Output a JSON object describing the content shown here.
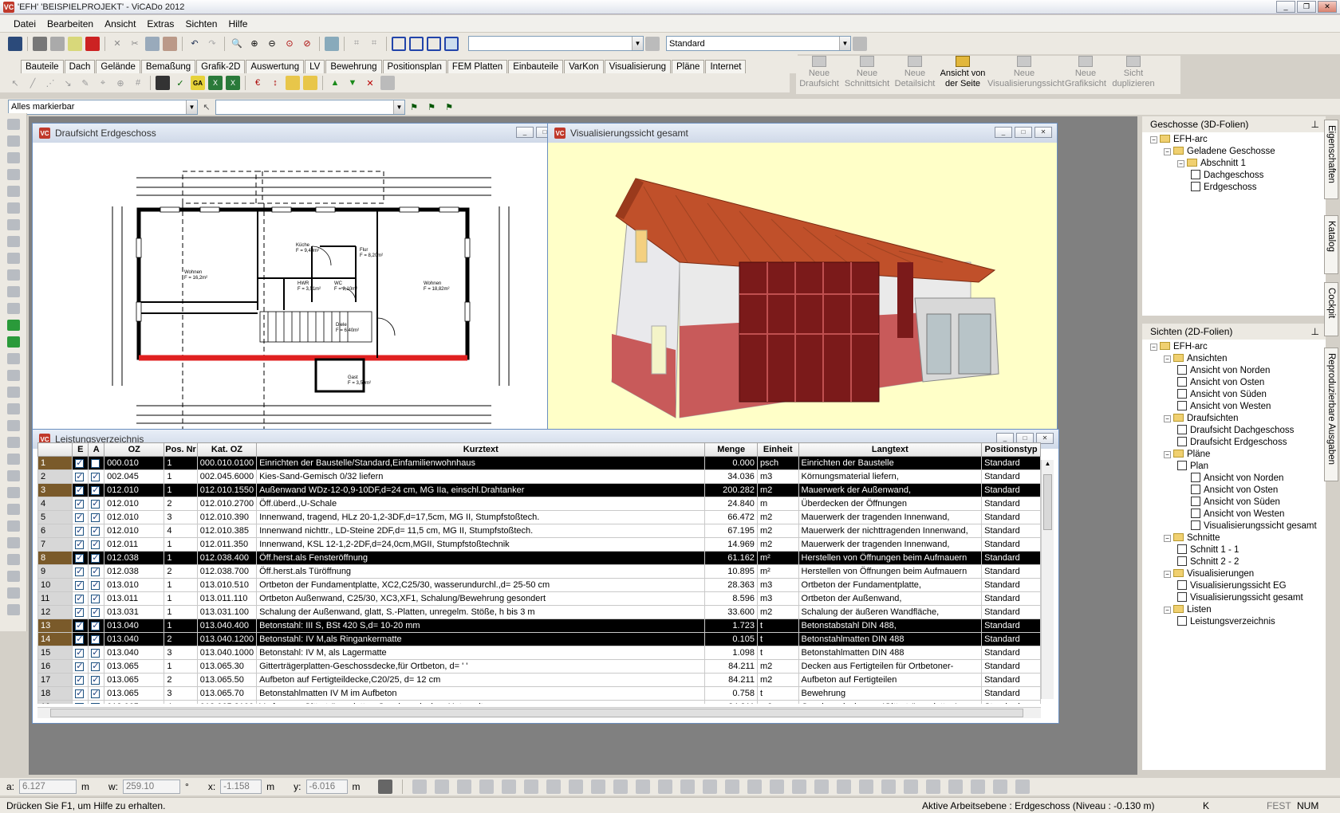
{
  "window": {
    "title": "'EFH' 'BEISPIELPROJEKT' - ViCADo 2012",
    "logo": "VC"
  },
  "menu": [
    "Datei",
    "Bearbeiten",
    "Ansicht",
    "Extras",
    "Sichten",
    "Hilfe"
  ],
  "toolbar": {
    "layer_combo": "",
    "style_combo": "Standard",
    "select_combo": "Alles markierbar",
    "filter_combo": ""
  },
  "tabs": [
    "Bauteile",
    "Dach",
    "Gelände",
    "Bemaßung",
    "Grafik-2D",
    "Auswertung",
    "LV",
    "Bewehrung",
    "Positionsplan",
    "FEM Platten",
    "Einbauteile",
    "VarKon",
    "Visualisierung",
    "Pläne",
    "Internet"
  ],
  "view_buttons": [
    {
      "label1": "Neue",
      "label2": "Draufsicht",
      "enabled": false
    },
    {
      "label1": "Neue",
      "label2": "Schnittsicht",
      "enabled": false
    },
    {
      "label1": "Neue",
      "label2": "Detailsicht",
      "enabled": false
    },
    {
      "label1": "Ansicht von",
      "label2": "der Seite",
      "enabled": true
    },
    {
      "label1": "Neue",
      "label2": "Visualisierungssicht",
      "enabled": false
    },
    {
      "label1": "Neue",
      "label2": "Grafiksicht",
      "enabled": false
    },
    {
      "label1": "Sicht",
      "label2": "duplizieren",
      "enabled": false
    }
  ],
  "panels": {
    "floorplan": {
      "title": "Draufsicht Erdgeschoss"
    },
    "visual": {
      "title": "Visualisierungssicht gesamt"
    },
    "lv": {
      "title": "Leistungsverzeichnis"
    }
  },
  "floorplan_rooms": [
    {
      "name": "Wohnen",
      "area": "F = 16,2m²"
    },
    {
      "name": "Küche",
      "area": "F = 9,40m²"
    },
    {
      "name": "Flur",
      "area": "F = 8,20m²"
    },
    {
      "name": "HWR",
      "area": "F = 3,51m²"
    },
    {
      "name": "WC",
      "area": "F = 2,10m²"
    },
    {
      "name": "Diele",
      "area": "F = 6,40m²"
    },
    {
      "name": "Wohnen",
      "area": "F = 18,82m²"
    },
    {
      "name": "Gast",
      "area": "F = 3,50m²"
    }
  ],
  "lv_table": {
    "columns": [
      "",
      "E",
      "A",
      "OZ",
      "Pos. Nr",
      "Kat. OZ",
      "Kurztext",
      "Menge",
      "Einheit",
      "Langtext",
      "Positionstyp"
    ],
    "rows": [
      {
        "n": "1",
        "e": true,
        "a": false,
        "oz": "000.010",
        "pos": "1",
        "kat": "000.010.0100",
        "kurz": "Einrichten der Baustelle/Standard,Einfamilienwohnhaus",
        "menge": "0.000",
        "einheit": "psch",
        "lang": "Einrichten der Baustelle",
        "typ": "Standard",
        "dark": true
      },
      {
        "n": "2",
        "e": true,
        "a": true,
        "oz": "002.045",
        "pos": "1",
        "kat": "002.045.6000",
        "kurz": "Kies-Sand-Gemisch 0/32 liefern",
        "menge": "34.036",
        "einheit": "m3",
        "lang": "Körnungsmaterial liefern,",
        "typ": "Standard",
        "dark": false
      },
      {
        "n": "3",
        "e": true,
        "a": true,
        "oz": "012.010",
        "pos": "1",
        "kat": "012.010.1550",
        "kurz": "Außenwand WDz-12-0,9-10DF,d=24 cm, MG IIa, einschl.Drahtanker",
        "menge": "200.282",
        "einheit": "m2",
        "lang": "Mauerwerk der Außenwand,",
        "typ": "Standard",
        "dark": true
      },
      {
        "n": "4",
        "e": true,
        "a": true,
        "oz": "012.010",
        "pos": "2",
        "kat": "012.010.2700",
        "kurz": "Öff.überd.,U-Schale",
        "menge": "24.840",
        "einheit": "m",
        "lang": "Überdecken der Öffnungen",
        "typ": "Standard",
        "dark": false
      },
      {
        "n": "5",
        "e": true,
        "a": true,
        "oz": "012.010",
        "pos": "3",
        "kat": "012.010.390",
        "kurz": "Innenwand, tragend, HLz 20-1,2-3DF,d=17,5cm, MG II, Stumpfstoßtech.",
        "menge": "66.472",
        "einheit": "m2",
        "lang": "Mauerwerk der tragenden Innenwand,",
        "typ": "Standard",
        "dark": false
      },
      {
        "n": "6",
        "e": true,
        "a": true,
        "oz": "012.010",
        "pos": "4",
        "kat": "012.010.385",
        "kurz": "Innenwand nichttr., LD-Steine 2DF,d= 11,5 cm, MG II, Stumpfstoßtech.",
        "menge": "67.195",
        "einheit": "m2",
        "lang": "Mauerwerk der nichttragenden Innenwand,",
        "typ": "Standard",
        "dark": false
      },
      {
        "n": "7",
        "e": true,
        "a": true,
        "oz": "012.011",
        "pos": "1",
        "kat": "012.011.350",
        "kurz": "Innenwand, KSL 12-1,2-2DF,d=24,0cm,MGII, Stumpfstoßtechnik",
        "menge": "14.969",
        "einheit": "m2",
        "lang": "Mauerwerk der tragenden Innenwand,",
        "typ": "Standard",
        "dark": false
      },
      {
        "n": "8",
        "e": true,
        "a": true,
        "oz": "012.038",
        "pos": "1",
        "kat": "012.038.400",
        "kurz": "Öff.herst.als Fensteröffnung",
        "menge": "61.162",
        "einheit": "m²",
        "lang": "Herstellen von Öffnungen beim Aufmauern",
        "typ": "Standard",
        "dark": true
      },
      {
        "n": "9",
        "e": true,
        "a": true,
        "oz": "012.038",
        "pos": "2",
        "kat": "012.038.700",
        "kurz": "Öff.herst.als Türöffnung",
        "menge": "10.895",
        "einheit": "m²",
        "lang": "Herstellen von Öffnungen beim Aufmauern",
        "typ": "Standard",
        "dark": false
      },
      {
        "n": "10",
        "e": true,
        "a": true,
        "oz": "013.010",
        "pos": "1",
        "kat": "013.010.510",
        "kurz": "Ortbeton der Fundamentplatte, XC2,C25/30, wasserundurchl.,d= 25-50 cm",
        "menge": "28.363",
        "einheit": "m3",
        "lang": "Ortbeton der Fundamentplatte,",
        "typ": "Standard",
        "dark": false
      },
      {
        "n": "11",
        "e": true,
        "a": true,
        "oz": "013.011",
        "pos": "1",
        "kat": "013.011.110",
        "kurz": "Ortbeton Außenwand, C25/30, XC3,XF1, Schalung/Bewehrung gesondert",
        "menge": "8.596",
        "einheit": "m3",
        "lang": "Ortbeton der Außenwand,",
        "typ": "Standard",
        "dark": false
      },
      {
        "n": "12",
        "e": true,
        "a": true,
        "oz": "013.031",
        "pos": "1",
        "kat": "013.031.100",
        "kurz": "Schalung der Außenwand, glatt, S.-Platten, unregelm. Stöße, h bis 3 m",
        "menge": "33.600",
        "einheit": "m2",
        "lang": "Schalung der äußeren Wandfläche,",
        "typ": "Standard",
        "dark": false
      },
      {
        "n": "13",
        "e": true,
        "a": true,
        "oz": "013.040",
        "pos": "1",
        "kat": "013.040.400",
        "kurz": "Betonstahl: III S, BSt 420 S,d= 10-20 mm",
        "menge": "1.723",
        "einheit": "t",
        "lang": "Betonstabstahl DIN 488,",
        "typ": "Standard",
        "dark": true
      },
      {
        "n": "14",
        "e": true,
        "a": true,
        "oz": "013.040",
        "pos": "2",
        "kat": "013.040.1200",
        "kurz": "Betonstahl: IV M,als Ringankermatte",
        "menge": "0.105",
        "einheit": "t",
        "lang": "Betonstahlmatten DIN 488",
        "typ": "Standard",
        "dark": true
      },
      {
        "n": "15",
        "e": true,
        "a": true,
        "oz": "013.040",
        "pos": "3",
        "kat": "013.040.1000",
        "kurz": "Betonstahl: IV M, als Lagermatte",
        "menge": "1.098",
        "einheit": "t",
        "lang": "Betonstahlmatten DIN 488",
        "typ": "Standard",
        "dark": false
      },
      {
        "n": "16",
        "e": true,
        "a": true,
        "oz": "013.065",
        "pos": "1",
        "kat": "013.065.30",
        "kurz": "Gitterträgerplatten-Geschossdecke,für Ortbeton, d= ' '",
        "menge": "84.211",
        "einheit": "m2",
        "lang": "Decken aus Fertigteilen für Ortbetoner-",
        "typ": "Standard",
        "dark": false
      },
      {
        "n": "17",
        "e": true,
        "a": true,
        "oz": "013.065",
        "pos": "2",
        "kat": "013.065.50",
        "kurz": "Aufbeton auf Fertigteildecke,C20/25, d= 12 cm",
        "menge": "84.211",
        "einheit": "m2",
        "lang": "Aufbeton auf Fertigteilen",
        "typ": "Standard",
        "dark": false
      },
      {
        "n": "18",
        "e": true,
        "a": true,
        "oz": "013.065",
        "pos": "3",
        "kat": "013.065.70",
        "kurz": "Betonstahlmatten IV M im Aufbeton",
        "menge": "0.758",
        "einheit": "t",
        "lang": "Bewehrung",
        "typ": "Standard",
        "dark": false
      },
      {
        "n": "19",
        "e": true,
        "a": true,
        "oz": "013.065",
        "pos": "4",
        "kat": "013.065.2100",
        "kurz": "Verfugung, Gitterträgerplatten-Geschossdecken-Unterseite",
        "menge": "84.211",
        "einheit": "m2",
        "lang": "Geschossdecke aus 'Gitterträgerplatten'",
        "typ": "Standard",
        "dark": false
      }
    ]
  },
  "tree_geschosse": {
    "title": "Geschosse (3D-Folien)",
    "items": [
      {
        "label": "EFH-arc",
        "level": 0,
        "kind": "fold"
      },
      {
        "label": "Geladene Geschosse",
        "level": 1,
        "kind": "fold"
      },
      {
        "label": "Abschnitt 1",
        "level": 2,
        "kind": "fold"
      },
      {
        "label": "Dachgeschoss",
        "level": 3,
        "kind": "doc"
      },
      {
        "label": "Erdgeschoss",
        "level": 3,
        "kind": "doc"
      }
    ]
  },
  "tree_sichten": {
    "title": "Sichten (2D-Folien)",
    "items": [
      {
        "label": "EFH-arc",
        "level": 0,
        "kind": "fold"
      },
      {
        "label": "Ansichten",
        "level": 1,
        "kind": "fold"
      },
      {
        "label": "Ansicht von Norden",
        "level": 2,
        "kind": "doc"
      },
      {
        "label": "Ansicht von Osten",
        "level": 2,
        "kind": "doc"
      },
      {
        "label": "Ansicht von Süden",
        "level": 2,
        "kind": "doc"
      },
      {
        "label": "Ansicht von Westen",
        "level": 2,
        "kind": "doc"
      },
      {
        "label": "Draufsichten",
        "level": 1,
        "kind": "fold"
      },
      {
        "label": "Draufsicht Dachgeschoss",
        "level": 2,
        "kind": "doc"
      },
      {
        "label": "Draufsicht Erdgeschoss",
        "level": 2,
        "kind": "doc"
      },
      {
        "label": "Pläne",
        "level": 1,
        "kind": "fold"
      },
      {
        "label": "Plan",
        "level": 2,
        "kind": "doc"
      },
      {
        "label": "Ansicht von Norden",
        "level": 3,
        "kind": "doc"
      },
      {
        "label": "Ansicht von Osten",
        "level": 3,
        "kind": "doc"
      },
      {
        "label": "Ansicht von Süden",
        "level": 3,
        "kind": "doc"
      },
      {
        "label": "Ansicht von Westen",
        "level": 3,
        "kind": "doc"
      },
      {
        "label": "Visualisierungssicht gesamt",
        "level": 3,
        "kind": "doc"
      },
      {
        "label": "Schnitte",
        "level": 1,
        "kind": "fold"
      },
      {
        "label": "Schnitt 1 - 1",
        "level": 2,
        "kind": "doc"
      },
      {
        "label": "Schnitt 2 - 2",
        "level": 2,
        "kind": "doc"
      },
      {
        "label": "Visualisierungen",
        "level": 1,
        "kind": "fold"
      },
      {
        "label": "Visualisierungssicht EG",
        "level": 2,
        "kind": "doc"
      },
      {
        "label": "Visualisierungssicht gesamt",
        "level": 2,
        "kind": "doc"
      },
      {
        "label": "Listen",
        "level": 1,
        "kind": "fold"
      },
      {
        "label": "Leistungsverzeichnis",
        "level": 2,
        "kind": "doc"
      }
    ]
  },
  "side_tabs": [
    "Eigenschaften",
    "Katalog",
    "Cockpit",
    "Reproduzierbare Ausgaben"
  ],
  "coords": {
    "a_label": "a:",
    "a_val": "6.127",
    "a_unit": "m",
    "w_label": "w:",
    "w_val": "259.10",
    "w_unit": "°",
    "x_label": "x:",
    "x_val": "-1.158",
    "x_unit": "m",
    "y_label": "y:",
    "y_val": "-6.016",
    "y_unit": "m"
  },
  "status": {
    "help": "Drücken Sie F1, um Hilfe zu erhalten.",
    "ebene": "Aktive Arbeitsebene : Erdgeschoss (Niveau : -0.130 m)",
    "k": "K",
    "fest": "FEST",
    "num": "NUM"
  },
  "colors": {
    "wall_red": "#e02020",
    "sky": "#ffffc8",
    "facade_red": "#c85a5a",
    "roof": "#c0502a"
  }
}
